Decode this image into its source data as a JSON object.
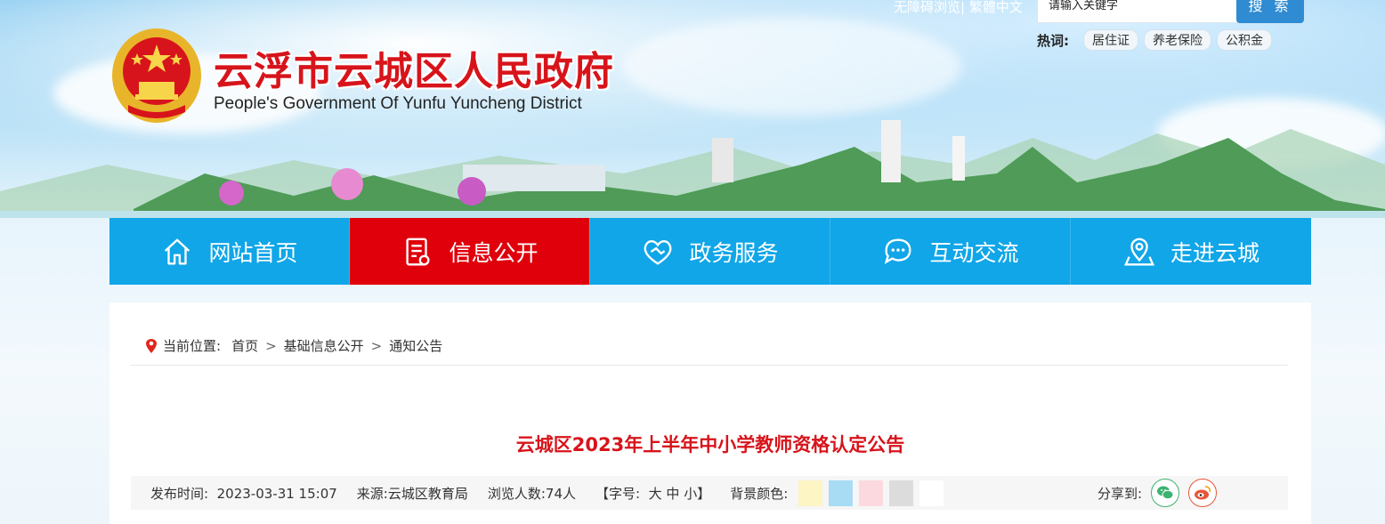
{
  "header": {
    "title": "云浮市云城区人民政府",
    "subtitle": "People's Government Of Yunfu Yuncheng District"
  },
  "toplinks": {
    "accessible": "无障碍浏览",
    "separator": "|",
    "traditional": "繁體中文"
  },
  "search": {
    "placeholder": "请输入关键字",
    "button": "搜 索"
  },
  "hot": {
    "label": "热词:",
    "tags": [
      "居住证",
      "养老保险",
      "公积金"
    ]
  },
  "nav": {
    "items": [
      {
        "label": "网站首页",
        "icon": "home-icon"
      },
      {
        "label": "信息公开",
        "icon": "document-icon",
        "active": true
      },
      {
        "label": "政务服务",
        "icon": "handshake-icon"
      },
      {
        "label": "互动交流",
        "icon": "chat-icon"
      },
      {
        "label": "走进云城",
        "icon": "location-icon"
      }
    ],
    "color": "#10a6e8",
    "active_color": "#e0000b"
  },
  "breadcrumb": {
    "label": "当前位置:",
    "items": [
      "首页",
      "基础信息公开",
      "通知公告"
    ],
    "separator": ">"
  },
  "article": {
    "title": "云城区2023年上半年中小学教师资格认定公告",
    "publish_label": "发布时间:",
    "publish_time": "2023-03-31 15:07",
    "source_label": "来源:",
    "source": "云城区教育局",
    "views_label": "浏览人数:",
    "views": "74人",
    "font_label": "【字号:",
    "font_large": "大",
    "font_medium": "中",
    "font_small": "小",
    "font_end": "】",
    "bg_label": "背景颜色:",
    "bg_colors": [
      "#fdf5c4",
      "#a7dcf4",
      "#fbd9df",
      "#dcdcdc",
      "#ffffff"
    ],
    "share_label": "分享到:"
  }
}
